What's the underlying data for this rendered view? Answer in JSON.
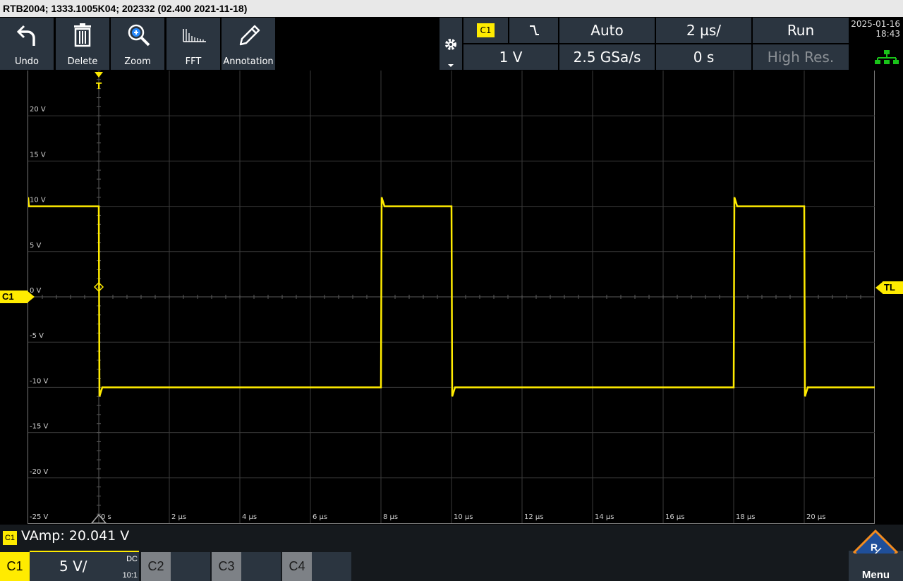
{
  "title": "RTB2004; 1333.1005K04; 202332 (02.400 2021-11-18)",
  "toolbar": {
    "undo": "Undo",
    "delete": "Delete",
    "zoom": "Zoom",
    "fft": "FFT",
    "annotation": "Annotation"
  },
  "acq": {
    "channel": "C1",
    "trigger_mode": "Auto",
    "time_scale": "2 µs/",
    "run_state": "Run",
    "trigger_level": "1 V",
    "sample_rate": "2.5 GSa/s",
    "time_offset": "0 s",
    "acq_mode": "High Res."
  },
  "clock": {
    "date": "2025-01-16",
    "time": "18:43"
  },
  "y_axis": [
    "20 V",
    "15 V",
    "10 V",
    "5 V",
    "0 V",
    "-5 V",
    "-10 V",
    "-15 V",
    "-20 V",
    "-25 V"
  ],
  "x_axis": [
    "0 s",
    "2 µs",
    "4 µs",
    "6 µs",
    "8 µs",
    "10 µs",
    "12 µs",
    "14 µs",
    "16 µs",
    "18 µs",
    "20 µs"
  ],
  "markers": {
    "channel": "C1",
    "trigger_level": "TL",
    "trigger": "T"
  },
  "measurement": {
    "channel": "C1",
    "text": "VAmp: 20.041 V"
  },
  "channels": {
    "c1": {
      "label": "C1",
      "scale": "5 V/",
      "coupling": "DC",
      "probe": "10:1"
    },
    "c2": {
      "label": "C2"
    },
    "c3": {
      "label": "C3"
    },
    "c4": {
      "label": "C4"
    }
  },
  "menu": "Menu",
  "colors": {
    "trace": "#ffeb00",
    "panel": "#2b3540",
    "grid": "#3a3a3a"
  },
  "chart_data": {
    "type": "line",
    "xlabel": "",
    "ylabel": "",
    "xlim_us": [
      -2,
      22
    ],
    "ylim_v": [
      -25,
      25
    ],
    "series": [
      {
        "x_us": [
          -2,
          -1.98,
          0,
          0.02,
          0.1,
          8,
          8.02,
          8.1,
          10,
          10.02,
          10.1,
          18,
          18.02,
          18.1,
          20,
          20.02,
          20.1,
          22
        ],
        "y_v": [
          11,
          10,
          10,
          -11,
          -10,
          -10,
          11,
          10,
          10,
          -11,
          -10,
          -10,
          11,
          10,
          10,
          -11,
          -10,
          -10
        ]
      }
    ]
  }
}
